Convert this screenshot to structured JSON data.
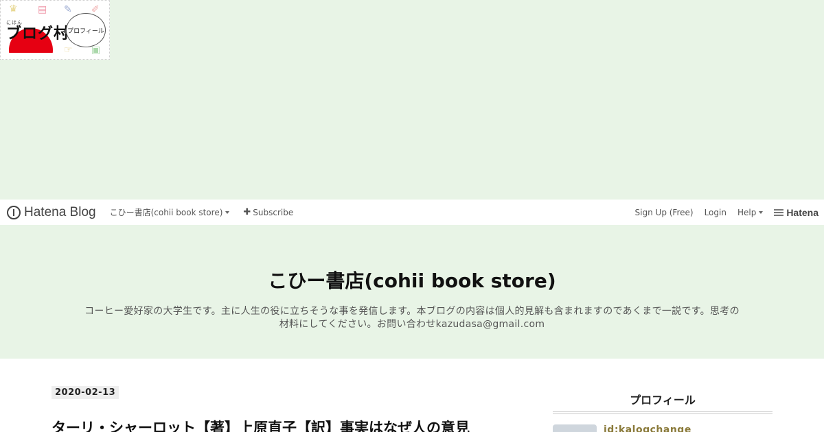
{
  "banner": {
    "brand_sub": "にほん",
    "brand": "ブログ村",
    "bubble": "プロフィール",
    "doodles": [
      "♛",
      "▤",
      "✎",
      "✐",
      "▭",
      "✂",
      "☞",
      "▣"
    ]
  },
  "navbar": {
    "logo": "Hatena Blog",
    "blog_menu": "こひー書店(cohii book store)",
    "subscribe": "Subscribe",
    "signup": "Sign Up (Free)",
    "login": "Login",
    "help": "Help",
    "hatena": "Hatena"
  },
  "header": {
    "title": "こひー書店(cohii book store)",
    "description": "コーヒー愛好家の大学生です。主に人生の役に立ちそうな事を発信します。本ブログの内容は個人的見解も含まれますのであくまで一説です。思考の材料にしてください。お問い合わせkazudasa@gmail.com"
  },
  "entry": {
    "date": "2020-02-13",
    "title": "ターリ・シャーロット【著】上原直子【訳】事実はなぜ人の意見"
  },
  "sidebar": {
    "title": "プロフィール",
    "profile_id": "id:kalogchange"
  },
  "colors": {
    "background": "#e8f4e6",
    "accent_id": "#8a7a3a",
    "brand_red": "#e60012"
  }
}
